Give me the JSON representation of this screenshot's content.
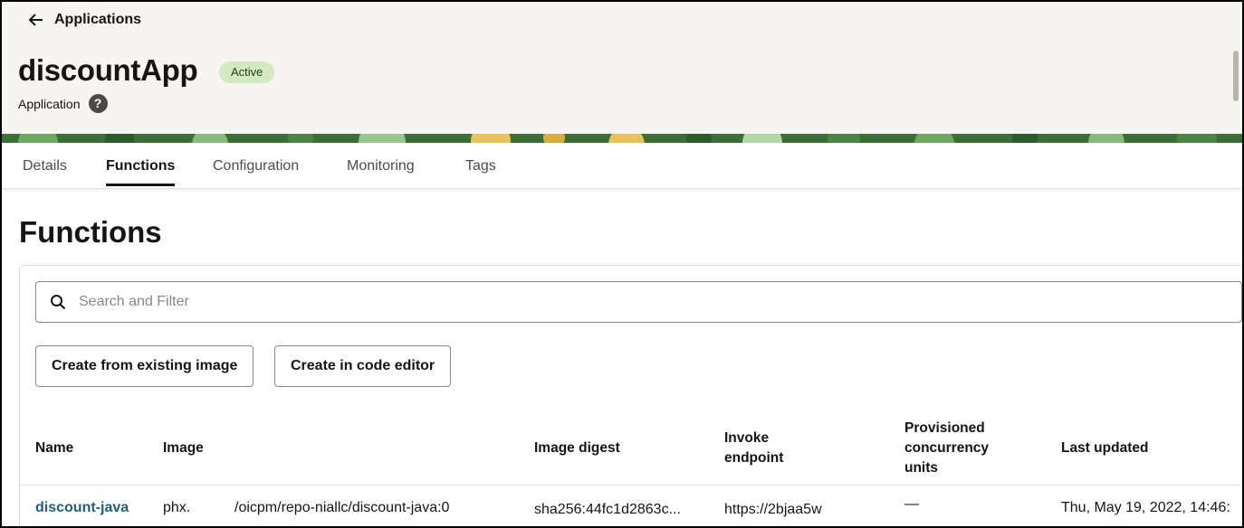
{
  "header": {
    "back_label": "Applications",
    "app_title": "discountApp",
    "status": "Active",
    "subtitle": "Application",
    "help_glyph": "?"
  },
  "colors": {
    "header_bg": "#f7f5f2",
    "badge_bg": "#d4e9c2",
    "link": "#1f5f7a",
    "banner_green": "#3d7a3a",
    "banner_yellow": "#e8c35a"
  },
  "tabs": [
    {
      "label": "Details",
      "active": false
    },
    {
      "label": "Functions",
      "active": true
    },
    {
      "label": "Configuration",
      "active": false
    },
    {
      "label": "Monitoring",
      "active": false
    },
    {
      "label": "Tags",
      "active": false
    }
  ],
  "main": {
    "section_title": "Functions",
    "search_placeholder": "Search and Filter",
    "buttons": {
      "create_image": "Create from existing image",
      "create_editor": "Create in code editor"
    }
  },
  "table": {
    "columns": {
      "name": "Name",
      "image": "Image",
      "digest": "Image digest",
      "endpoint_1": "Invoke",
      "endpoint_2": "endpoint",
      "concurrency_1": "Provisioned",
      "concurrency_2": "concurrency",
      "concurrency_3": "units",
      "updated": "Last updated"
    },
    "rows": [
      {
        "name": "discount-java",
        "image_prefix": "phx.",
        "image_path": "/oicpm/repo-niallc/discount-java:0",
        "digest": "sha256:44fc1d2863c...",
        "endpoint": "https://2bjaa5w",
        "concurrency": "—",
        "updated": "Thu, May 19, 2022, 14:46:"
      }
    ]
  },
  "icons": {
    "back": "arrow-left-icon",
    "help": "help-circle-icon",
    "search": "search-icon"
  }
}
